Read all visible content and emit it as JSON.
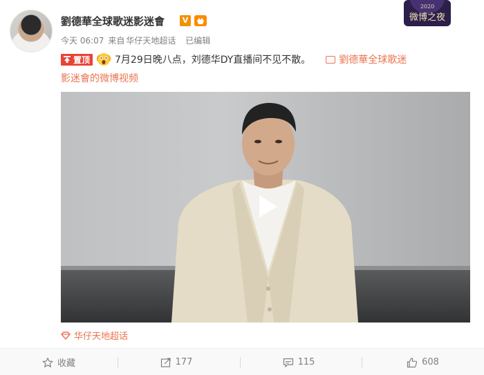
{
  "header": {
    "username": "劉德華全球歌迷影迷會",
    "verified_label": "V",
    "time": "今天 06:07",
    "source_prefix": "来自",
    "source_name": "华仔天地超话",
    "edited_label": "已编辑",
    "corner_badge_text": "微博之夜",
    "corner_badge_year": "2020"
  },
  "post": {
    "pin_label": "置顶",
    "text": "7月29日晚八点，刘德华DY直播间不见不散。",
    "video_link_line1": "劉德華全球歌迷",
    "video_link_line2": "影迷會的微博视频"
  },
  "topic": {
    "label": "华仔天地超话"
  },
  "actions": {
    "favorite_label": "收藏",
    "repost_count": "177",
    "comment_count": "115",
    "like_count": "608"
  },
  "colors": {
    "accent": "#eb7350",
    "pin_red": "#e94335",
    "verified_orange": "#f29100",
    "muted_text": "#808080"
  }
}
